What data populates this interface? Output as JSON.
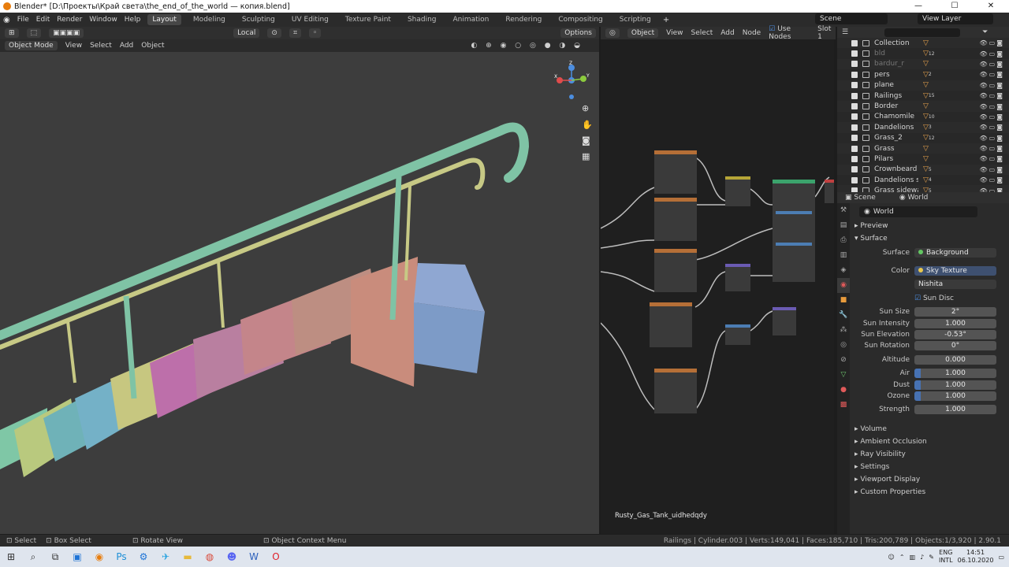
{
  "window": {
    "title": "Blender* [D:\\Проекты\\Край света\\the_end_of_the_world — копия.blend]",
    "controls": [
      "—",
      "☐",
      "✕"
    ]
  },
  "menus": [
    "File",
    "Edit",
    "Render",
    "Window",
    "Help"
  ],
  "workspace_tabs": [
    "Layout",
    "Modeling",
    "Sculpting",
    "UV Editing",
    "Texture Paint",
    "Shading",
    "Animation",
    "Rendering",
    "Compositing",
    "Scripting"
  ],
  "scene": "Scene",
  "view_layer": "View Layer",
  "viewport": {
    "orientation": "Local",
    "options": "Options",
    "mode": "Object Mode",
    "menus": [
      "View",
      "Select",
      "Add",
      "Object"
    ],
    "axes": {
      "x": "X",
      "y": "Y",
      "z": "Z"
    }
  },
  "node_editor": {
    "type": "Object",
    "menus": [
      "View",
      "Select",
      "Add",
      "Node"
    ],
    "use_nodes": "Use Nodes",
    "slot": "Slot 1",
    "material_label": "Rusty_Gas_Tank_uidhedqdy"
  },
  "outliner": {
    "search_placeholder": "",
    "items": [
      {
        "name": "Collection",
        "badge": "",
        "dim": false
      },
      {
        "name": "bld",
        "badge": "12",
        "dim": true
      },
      {
        "name": "bardur_r",
        "badge": "",
        "dim": true
      },
      {
        "name": "pers",
        "badge": "2",
        "dim": false
      },
      {
        "name": "plane",
        "badge": "",
        "dim": false
      },
      {
        "name": "Railings",
        "badge": "15",
        "dim": false
      },
      {
        "name": "Border",
        "badge": "",
        "dim": false
      },
      {
        "name": "Chamomile",
        "badge": "10",
        "dim": false
      },
      {
        "name": "Dandelions",
        "badge": "3",
        "dim": false
      },
      {
        "name": "Grass_2",
        "badge": "12",
        "dim": false
      },
      {
        "name": "Grass",
        "badge": "",
        "dim": false
      },
      {
        "name": "Pilars",
        "badge": "",
        "dim": false
      },
      {
        "name": "Crownbeard",
        "badge": "5",
        "dim": false
      },
      {
        "name": "Dandelions sidewalk",
        "badge": "4",
        "dim": false
      },
      {
        "name": "Grass sidewalk",
        "badge": "5",
        "dim": false
      }
    ]
  },
  "properties": {
    "breadcrumb": {
      "scene": "Scene",
      "world": "World"
    },
    "datablock": "World",
    "sections": {
      "preview": "Preview",
      "surface": "Surface"
    },
    "surface": {
      "label": "Surface",
      "value": "Background"
    },
    "color": {
      "label": "Color",
      "value": "Sky Texture"
    },
    "sky_type": "Nishita",
    "sun_disc": "Sun Disc",
    "fields": [
      {
        "label": "Sun Size",
        "value": "2°"
      },
      {
        "label": "Sun Intensity",
        "value": "1.000"
      },
      {
        "label": "Sun Elevation",
        "value": "-0.53°"
      },
      {
        "label": "Sun Rotation",
        "value": "0°"
      }
    ],
    "altitude": {
      "label": "Altitude",
      "value": "0.000"
    },
    "density": [
      {
        "label": "Air",
        "value": "1.000"
      },
      {
        "label": "Dust",
        "value": "1.000"
      },
      {
        "label": "Ozone",
        "value": "1.000"
      }
    ],
    "strength": {
      "label": "Strength",
      "value": "1.000"
    },
    "collapsed": [
      "Volume",
      "Ambient Occlusion",
      "Ray Visibility",
      "Settings",
      "Viewport Display",
      "Custom Properties"
    ]
  },
  "statusbar": {
    "select": "Select",
    "box_select": "Box Select",
    "rotate_view": "Rotate View",
    "context_menu": "Object Context Menu",
    "stats": "Railings | Cylinder.003 | Verts:149,041 | Faces:185,710 | Tris:200,789 | Objects:1/3,920 | 2.90.1"
  },
  "taskbar": {
    "lang_1": "ENG",
    "lang_2": "INTL",
    "time": "14:51",
    "date": "06.10.2020"
  }
}
